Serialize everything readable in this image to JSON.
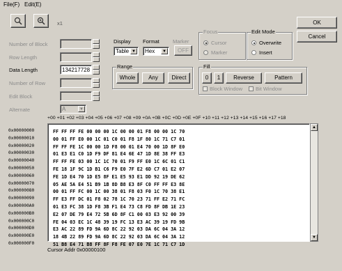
{
  "menu": {
    "file": "File(F)",
    "edit": "Edit(E)"
  },
  "toolbar": {
    "zoom_label": "x1"
  },
  "dialog_buttons": {
    "ok": "OK",
    "cancel": "Cancel"
  },
  "left_fields": {
    "number_of_block": "Number of Block",
    "row_length": "Row Length",
    "data_length": "Data Length",
    "data_length_value": "134217728",
    "number_of_row": "Number of Row",
    "edit_block": "Edit Block",
    "alternate": "Alternate",
    "alternate_value": "A"
  },
  "display": {
    "label": "Display",
    "value": "Table"
  },
  "format": {
    "label": "Format",
    "value": "Hex"
  },
  "marker": {
    "label": "Marker",
    "button": "OFF"
  },
  "focus": {
    "title": "Focus",
    "cursor": "Cursor",
    "marker": "Marker"
  },
  "edit_mode": {
    "title": "Edit Mode",
    "overwrite": "Overwrite",
    "insert": "Insert"
  },
  "range": {
    "title": "Range",
    "whole": "Whole",
    "any": "Any",
    "direct": "Direct"
  },
  "fill": {
    "title": "Fill",
    "zero": "0",
    "one": "1",
    "reverse": "Reverse",
    "pattern": "Pattern",
    "block_window": "Block Window",
    "bit_window": "Bit Window"
  },
  "hex_header": "+00 +01 +02 +03 +04 +05 +06 +07 +08 +09 +0A +0B +0C +0D +0E +0F +10 +11 +12 +13 +14 +15 +16 +17 +18",
  "addresses": [
    "0x00000000",
    "0x00000010",
    "0x00000020",
    "0x00000030",
    "0x00000040",
    "0x00000050",
    "0x00000060",
    "0x00000070",
    "0x00000080",
    "0x00000090",
    "0x000000A0",
    "0x000000B0",
    "0x000000C0",
    "0x000000D0",
    "0x000000E0",
    "0x000000F0"
  ],
  "hex_rows": [
    "FF FF FF FE 00 00 00 1C 00 00 01 F8 00 00 1C 70",
    "00 01 FF E0 00 1C 01 C0 01 F8 1F 80 1C 71 C7 01",
    "FF FF FE 1C 00 00 1D F8 00 01 E4 70 00 1D 8F E0",
    "01 E3 E1 C0 1D F9 DF 81 E4 6E 47 1D 8E 38 FF E3",
    "FF FF FE 03 00 1C 1C 70 01 F9 FF E0 1C 6C 01 C1",
    "FE 18 1F 9C 1D B1 C6 F9 E0 7F E2 6D C7 01 E2 07",
    "FE 1D E4 70 1D E5 8F E1 E5 93 E1 DD 92 19 DE 62",
    "05 AE 5A E4 51 B9 1B 8D B8 E3 8F C0 FF FF E3 8E",
    "00 01 FF FC 00 1C 00 38 01 F8 03 F0 1C 70 38 E1",
    "FF E3 FF DC 01 F8 02 78 1C 70 23 71 FF E2 71 FC",
    "01 E3 FC 38 1D F8 3B F1 E4 73 C8 FD 8F DB 1E 23",
    "E2 07 DE 79 E4 72 5B 6D 8F C1 00 03 E3 92 00 39",
    "FE 04 03 EC 1C 48 39 19 FC 13 E3 AC 39 19 FD 9B",
    "E3 AC 22 89 FD 9A 6D 8C 22 92 03 DA 6C 04 3A 12",
    "18 4B 22 89 FD 9A 6D 8C 22 92 03 DA 6C 04 3A 12",
    "51 B8 E4 71 B8 FF 8F F8 FE 07 E0 7E 1C 71 C7 1D"
  ],
  "status": {
    "cursor_addr": "Cursor Addr  0x00000100"
  }
}
